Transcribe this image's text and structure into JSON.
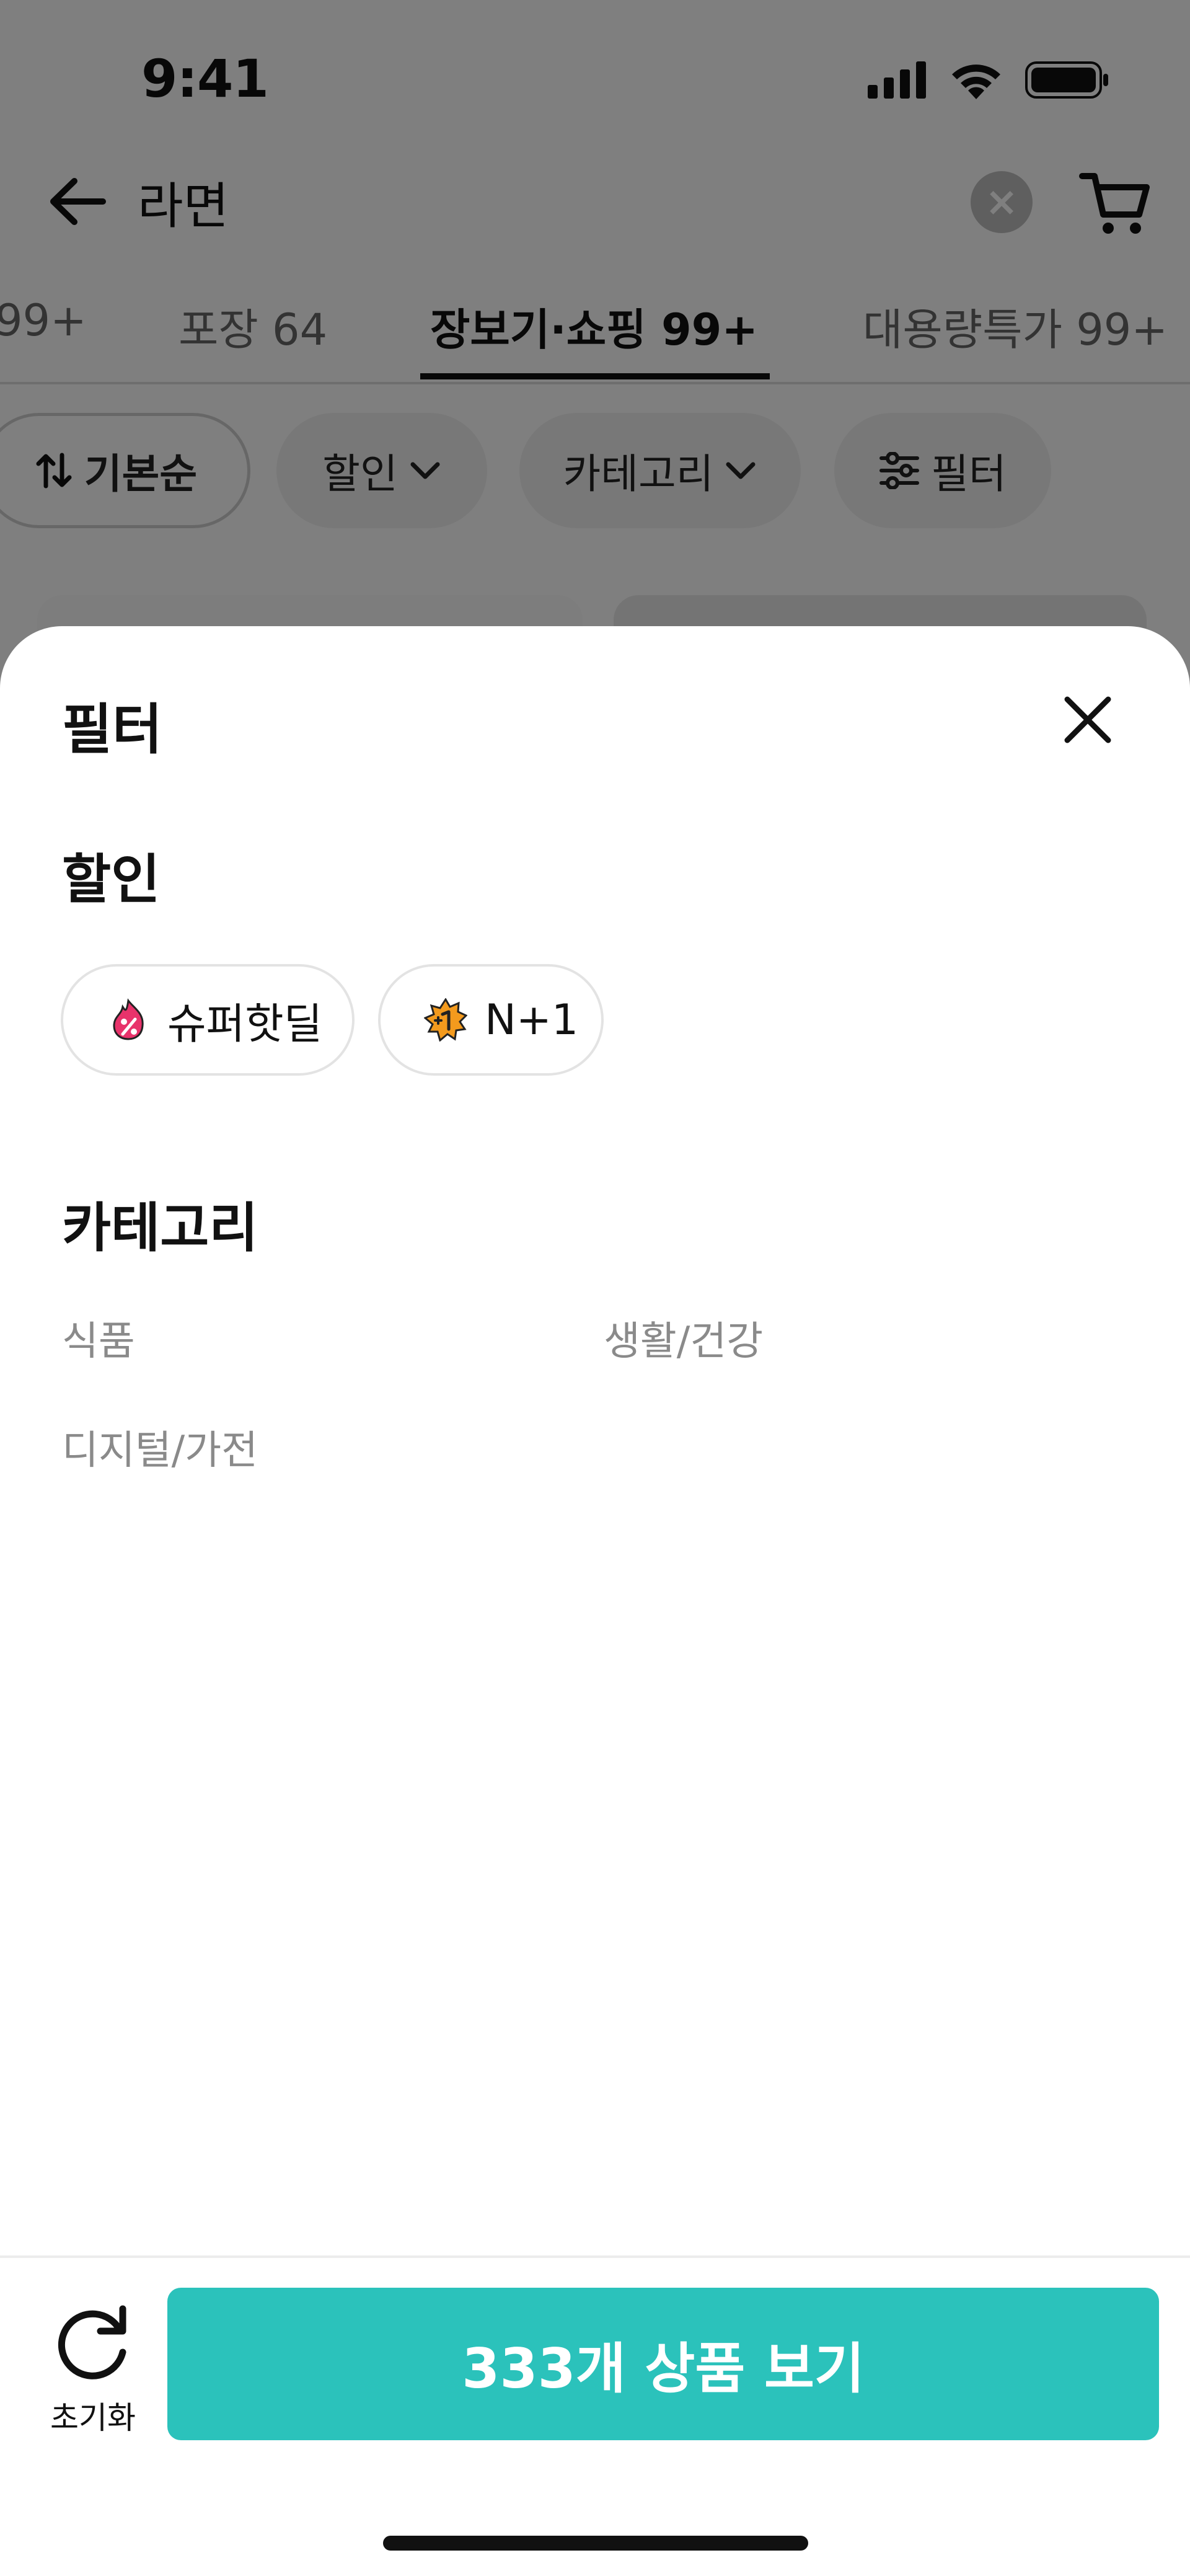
{
  "status_bar": {
    "time": "9:41"
  },
  "search": {
    "query": "라면"
  },
  "tabs": [
    {
      "label": "99+"
    },
    {
      "label": "포장 64"
    },
    {
      "label": "장보기·쇼핑 99+",
      "active": true
    },
    {
      "label": "대용량특가 99+"
    }
  ],
  "filter_chips": {
    "sort": "기본순",
    "discount": "할인",
    "category": "카테고리",
    "filter": "필터"
  },
  "sheet": {
    "title": "필터",
    "discount_section": {
      "title": "할인",
      "options": [
        {
          "label": "슈퍼핫딜",
          "icon": "super-hot-deal-icon"
        },
        {
          "label": "N+1",
          "icon": "n-plus-one-icon"
        }
      ]
    },
    "category_section": {
      "title": "카테고리",
      "items": [
        "식품",
        "생활/건강",
        "디지털/가전"
      ]
    },
    "reset_label": "초기화",
    "cta_label": "333개 상품 보기"
  },
  "colors": {
    "accent": "#2bc2bb",
    "overlay": "rgba(0,0,0,0.5)",
    "hot_deal": "#e8336b",
    "n_plus_one": "#f39a1d"
  }
}
